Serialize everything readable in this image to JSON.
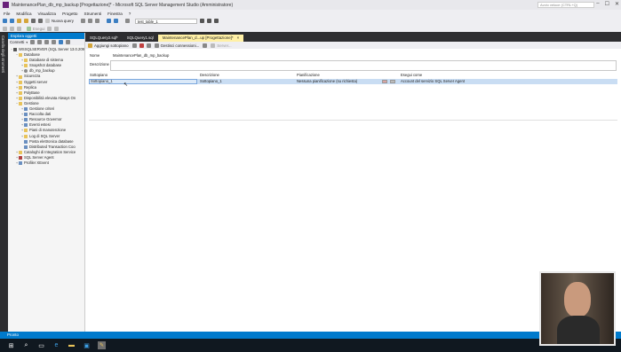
{
  "window": {
    "title": "MaintenancePlan_db_mp_backup [Progettazione]* - Microsoft SQL Server Management Studio (Amministratore)",
    "quick_launch_placeholder": "Avvio veloce (CTRL+Q)"
  },
  "menu": [
    "File",
    "Modifica",
    "Visualizza",
    "Progetto",
    "Strumenti",
    "Finestra",
    "?"
  ],
  "toolbar": {
    "new_query": "Nuova query",
    "database_select": "test_table_1",
    "execute": "Esegui"
  },
  "side_strip": {
    "label": "Casella degli strumenti"
  },
  "object_explorer": {
    "title": "Esplora oggetti",
    "connect": "Connetti",
    "tree": [
      {
        "level": 0,
        "expander": "−",
        "icon": "server",
        "label": "WSSQLSERVER (SQL Server 13.0.209"
      },
      {
        "level": 1,
        "expander": "−",
        "icon": "folder",
        "label": "Database"
      },
      {
        "level": 2,
        "expander": "+",
        "icon": "folder",
        "label": "Database di sistema"
      },
      {
        "level": 2,
        "expander": "+",
        "icon": "folder",
        "label": "Snapshot database"
      },
      {
        "level": 2,
        "expander": "+",
        "icon": "db",
        "label": "db_mp_backup"
      },
      {
        "level": 1,
        "expander": "+",
        "icon": "folder",
        "label": "Sicurezza"
      },
      {
        "level": 1,
        "expander": "+",
        "icon": "folder",
        "label": "Oggetti server"
      },
      {
        "level": 1,
        "expander": "+",
        "icon": "folder",
        "label": "Replica"
      },
      {
        "level": 1,
        "expander": "+",
        "icon": "folder",
        "label": "PolyBase"
      },
      {
        "level": 1,
        "expander": "+",
        "icon": "folder",
        "label": "Disponibilità elevata Always On"
      },
      {
        "level": 1,
        "expander": "−",
        "icon": "folder",
        "label": "Gestione"
      },
      {
        "level": 2,
        "expander": "+",
        "icon": "mgmt",
        "label": "Gestione criteri"
      },
      {
        "level": 2,
        "expander": "+",
        "icon": "mgmt",
        "label": "Raccolta dati"
      },
      {
        "level": 2,
        "expander": "+",
        "icon": "mgmt",
        "label": "Resource Governor"
      },
      {
        "level": 2,
        "expander": "+",
        "icon": "mgmt",
        "label": "Eventi estesi"
      },
      {
        "level": 2,
        "expander": "+",
        "icon": "folder",
        "label": "Piani di manutenzione"
      },
      {
        "level": 2,
        "expander": "+",
        "icon": "folder",
        "label": "Log di SQL Server"
      },
      {
        "level": 2,
        "expander": "",
        "icon": "mgmt",
        "label": "Posta elettronica database"
      },
      {
        "level": 2,
        "expander": "",
        "icon": "mgmt",
        "label": "Distributed Transaction Coo"
      },
      {
        "level": 1,
        "expander": "+",
        "icon": "folder",
        "label": "Cataloghi di Integration Service"
      },
      {
        "level": 1,
        "expander": "+",
        "icon": "agent",
        "label": "SQL Server Agent"
      },
      {
        "level": 1,
        "expander": "+",
        "icon": "mgmt",
        "label": "Profiler XEvent"
      }
    ]
  },
  "tabs": [
    {
      "label": "SQLQuery2.sql*",
      "active": false,
      "close": ""
    },
    {
      "label": "SQLQuery1.sql",
      "active": false,
      "close": ""
    },
    {
      "label": "MaintenancePlan_d...up [Progettazione]*",
      "active": true,
      "close": "×"
    }
  ],
  "designer": {
    "add_subplan": "Aggiungi sottopiano",
    "manage_connections": "Gestisci connessioni...",
    "servers": "Server...",
    "name_label": "Nome",
    "name_value": "MaintenancePlan_db_mp_backup",
    "description_label": "Descrizione",
    "description_value": "",
    "grid": {
      "columns": [
        "Sottopiano",
        "Descrizione",
        "Pianificazione",
        "Esegui come"
      ],
      "row": {
        "subplan": "Sottopiano_1",
        "description": "Sottopiano_1",
        "schedule": "Nessuna pianificazione (su richiesta)",
        "run_as": "Account del servizio SQL Server Agent"
      }
    }
  },
  "status_bar": {
    "text": "Pronto"
  },
  "colors": {
    "accent": "#007acc",
    "active_tab": "#fff0a6",
    "selected_row": "#c9ddf3"
  }
}
